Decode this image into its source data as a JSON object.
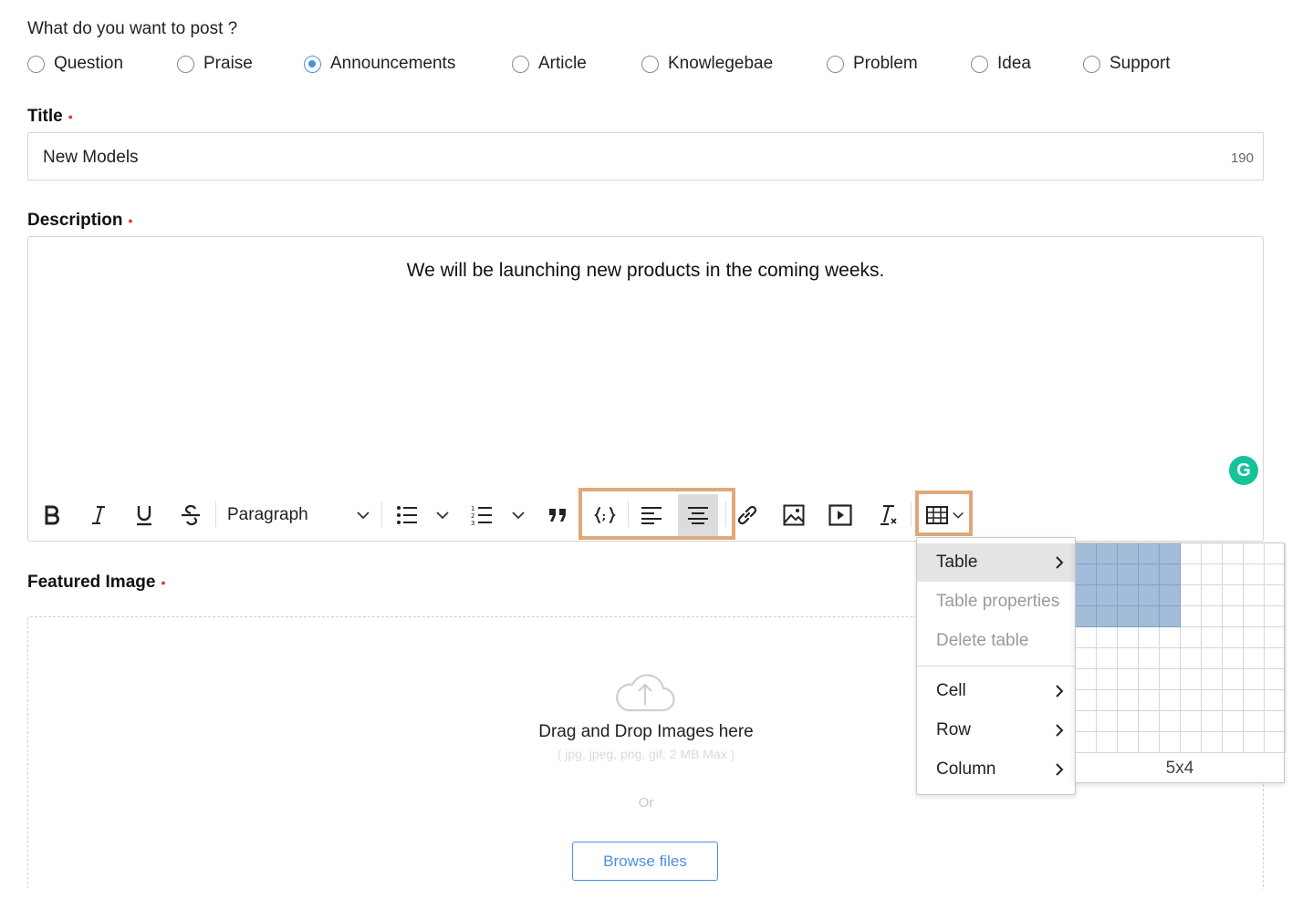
{
  "form": {
    "post_type_prompt": "What do you want to post ?",
    "post_types": [
      {
        "label": "Question",
        "selected": false
      },
      {
        "label": "Praise",
        "selected": false
      },
      {
        "label": "Announcements",
        "selected": true
      },
      {
        "label": "Article",
        "selected": false
      },
      {
        "label": "Knowlegebae",
        "selected": false
      },
      {
        "label": "Problem",
        "selected": false
      },
      {
        "label": "Idea",
        "selected": false
      },
      {
        "label": "Support",
        "selected": false
      }
    ],
    "title": {
      "label": "Title",
      "required_mark": "•",
      "value": "New Models",
      "char_count": "190"
    },
    "description": {
      "label": "Description",
      "required_mark": "•",
      "content": "We will be launching new products in the coming weeks."
    },
    "featured_image": {
      "label": "Featured Image",
      "required_mark": "•",
      "drop_text": "Drag and Drop Images here",
      "formats_hint": "( jpg, jpeg, png, gif; 2 MB Max )",
      "or_text": "Or",
      "browse_label": "Browse files"
    }
  },
  "toolbar": {
    "bold": "bold-icon",
    "italic": "italic-icon",
    "underline": "underline-icon",
    "strikethrough": "strikethrough-icon",
    "block_format": "Paragraph",
    "grammarly_letter": "G"
  },
  "table_menu": {
    "items": [
      {
        "label": "Table",
        "has_submenu": true,
        "disabled": false,
        "active": true
      },
      {
        "label": "Table properties",
        "has_submenu": false,
        "disabled": true,
        "active": false
      },
      {
        "label": "Delete table",
        "has_submenu": false,
        "disabled": true,
        "active": false
      },
      {
        "label": "Cell",
        "has_submenu": true,
        "disabled": false,
        "active": false
      },
      {
        "label": "Row",
        "has_submenu": true,
        "disabled": false,
        "active": false
      },
      {
        "label": "Column",
        "has_submenu": true,
        "disabled": false,
        "active": false
      }
    ],
    "grid_selection_label": "5x4",
    "grid_selected_cols": 5,
    "grid_selected_rows": 4
  },
  "colors": {
    "accent": "#4a90e2",
    "required": "#e53935",
    "highlight_box": "#e0a878",
    "grid_selected": "#a3bcd9",
    "grammarly": "#15c39a"
  }
}
